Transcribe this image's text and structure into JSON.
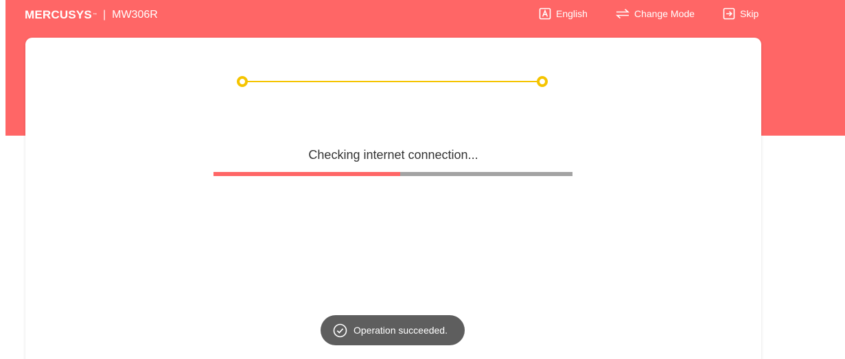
{
  "header": {
    "brand": "MERCUSYS",
    "brand_tm": "™",
    "separator": "|",
    "model": "MW306R",
    "actions": [
      {
        "label": "English",
        "icon": "language-icon"
      },
      {
        "label": "Change Mode",
        "icon": "change-mode-icon"
      },
      {
        "label": "Skip",
        "icon": "skip-icon"
      }
    ]
  },
  "main": {
    "status_text": "Checking internet connection...",
    "progress": 0.52
  },
  "toast": {
    "message": "Operation succeeded.",
    "icon": "check-circle-icon"
  },
  "colors": {
    "brand": "#ff6666",
    "step_accent": "#f5c400",
    "progress_track": "#a3a3a3",
    "toast_bg": "#5e5e5e"
  }
}
